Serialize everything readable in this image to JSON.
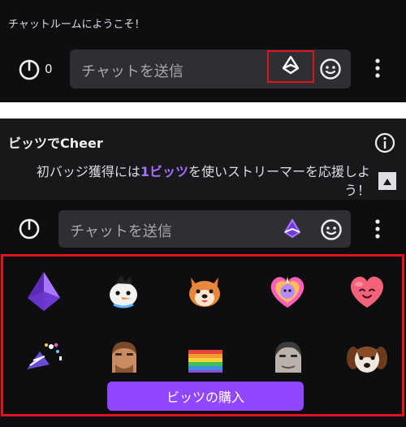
{
  "top_panel": {
    "welcome_text": "チャットルームにようこそ！",
    "bits_count": "0",
    "chat_placeholder": "チャットを送信"
  },
  "cheer_panel": {
    "title": "ビッツでCheer",
    "description_pre": "初バッジ獲得には",
    "description_highlight": "1ビッツ",
    "description_post": "を使いストリーマーを応援しよう！",
    "chat_placeholder": "チャットを送信",
    "buy_button_label": "ビッツの購入"
  },
  "cheermotes": [
    {
      "name": "purple-crystal"
    },
    {
      "name": "snowman"
    },
    {
      "name": "shiba"
    },
    {
      "name": "unicorn-heart"
    },
    {
      "name": "pink-heart"
    },
    {
      "name": "party-popper"
    },
    {
      "name": "man-face"
    },
    {
      "name": "rainbow-flag"
    },
    {
      "name": "face-photo"
    },
    {
      "name": "dog"
    }
  ],
  "colors": {
    "background": "#0e0e10",
    "input": "#2e2e33",
    "accent": "#9147ff",
    "highlight_text": "#a970ff",
    "annotation_red": "#e0141e"
  }
}
